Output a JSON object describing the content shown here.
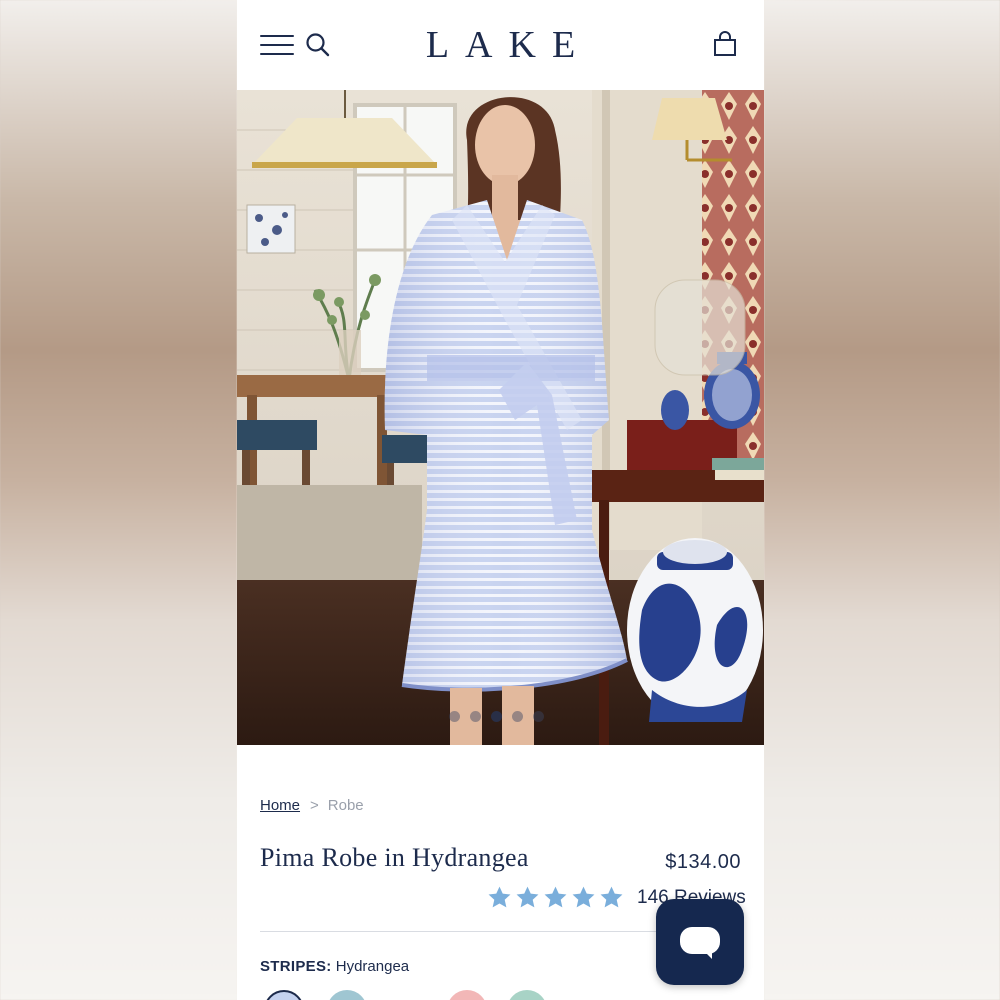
{
  "header": {
    "logo": "LAKE",
    "menu_icon": "hamburger-menu-icon",
    "search_icon": "search-icon",
    "bag_icon": "shopping-bag-icon"
  },
  "hero": {
    "image_subject": "model wearing striped robe",
    "carousel_dots": 5,
    "active_dot": 3
  },
  "breadcrumb": {
    "home": "Home",
    "separator": ">",
    "current": "Robe"
  },
  "product": {
    "title": "Pima Robe in Hydrangea",
    "price": "$134.00",
    "rating": 5,
    "rating_max": 5,
    "reviews_label": "146 Reviews"
  },
  "options": {
    "label": "STRIPES:",
    "value": " Hydrangea"
  },
  "chat": {
    "icon": "chat-bubble-icon"
  },
  "colors": {
    "brand_navy": "#1d2b4c",
    "star_blue": "#7aaedb",
    "chat_navy": "#15284f"
  }
}
